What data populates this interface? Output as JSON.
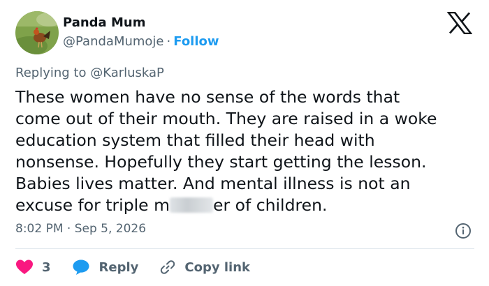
{
  "author": {
    "display_name": "Panda Mum",
    "handle": "@PandaMumoje",
    "separator": "·",
    "follow_label": "Follow",
    "avatar_icon": "rooster-avatar"
  },
  "platform_icon": "x-logo-icon",
  "reply_context": {
    "prefix": "Replying to",
    "mention": "@KarluskaP"
  },
  "tweet": {
    "lines": [
      "These women have no sense of the words that",
      "come out of their mouth. They are raised in a woke",
      "education system that filled their head with",
      "nonsense. Hopefully they start getting the lesson.",
      "Babies lives matter. And mental illness is not an"
    ],
    "last_line_before": "excuse for triple m",
    "last_line_after": "er of children."
  },
  "timestamp": "8:02 PM · Sep 5, 2026",
  "actions": {
    "like_count": "3",
    "reply_label": "Reply",
    "copy_label": "Copy link"
  },
  "colors": {
    "text": "#0f1419",
    "secondary": "#536471",
    "accent": "#1d9bf0",
    "like": "#f91880",
    "divider": "#e1e8ed"
  }
}
